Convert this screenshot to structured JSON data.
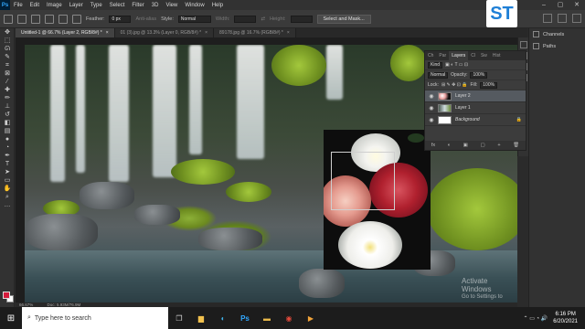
{
  "menubar": {
    "logo": "Ps",
    "items": [
      "File",
      "Edit",
      "Image",
      "Layer",
      "Type",
      "Select",
      "Filter",
      "3D",
      "View",
      "Window",
      "Help"
    ]
  },
  "options": {
    "feather_label": "Feather:",
    "feather_value": "0 px",
    "antialias": "Anti-alias",
    "style_label": "Style:",
    "style_value": "Normal",
    "width_label": "Width:",
    "height_label": "Height:",
    "select_mask": "Select and Mask..."
  },
  "logo_badge": "ST",
  "tabs": [
    {
      "label": "Untitled-1 @ 66.7% (Layer 2, RGB/8#) *"
    },
    {
      "label": "01 (3).jpg @ 13.3% (Layer 0, RGB/8#) *"
    },
    {
      "label": "89178.jpg @ 16.7% (RGB/8#) *"
    }
  ],
  "layers_panel": {
    "tabs": [
      "Ch",
      "Par",
      "Layers",
      "Cl",
      "Sw",
      "Hist"
    ],
    "kind": "Kind",
    "blend_mode": "Normal",
    "opacity_label": "Opacity:",
    "opacity_value": "100%",
    "lock_label": "Lock:",
    "fill_label": "Fill:",
    "fill_value": "100%",
    "layers": [
      {
        "name": "Layer 2",
        "selected": true
      },
      {
        "name": "Layer 1",
        "selected": false
      },
      {
        "name": "Background",
        "selected": false
      }
    ],
    "footer": [
      "fx",
      "◐",
      "▣",
      "▢",
      "+",
      "🗑"
    ]
  },
  "dock": {
    "items": [
      {
        "label": "Channels"
      },
      {
        "label": "Paths"
      }
    ]
  },
  "status": {
    "zoom": "66.67%",
    "doc": "Doc: 5.93M/76.9M"
  },
  "watermark": {
    "title": "Activate Windows",
    "subtitle": "Go to Settings to activate Windows."
  },
  "taskbar": {
    "search_placeholder": "Type here to search",
    "time": "6:16 PM",
    "date": "6/20/2021"
  },
  "colors": {
    "foreground": "#d41c3c",
    "background": "#ffffff",
    "ps_blue": "#31a8ff"
  }
}
